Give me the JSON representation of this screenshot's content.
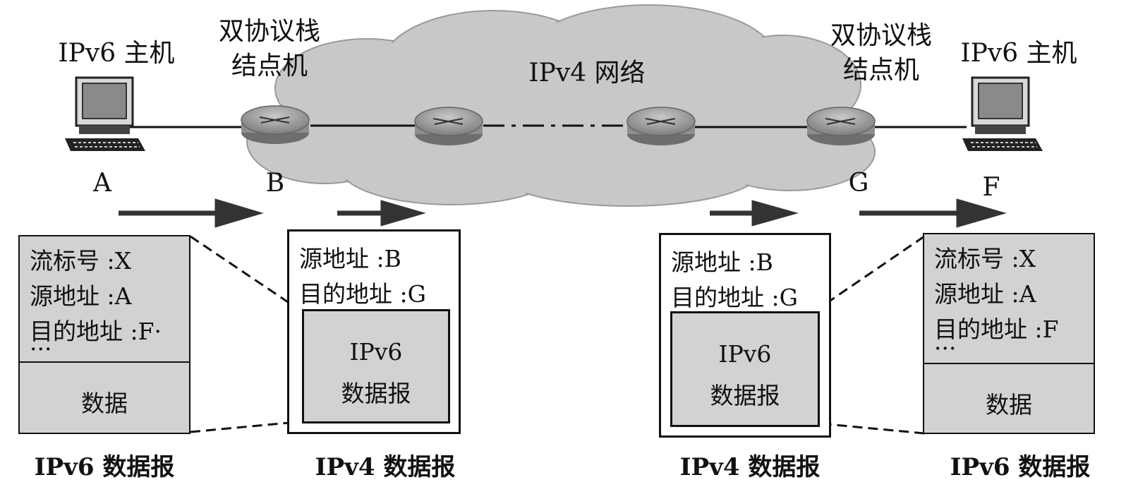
{
  "cloud_label": "IPv4 网络",
  "nodes": {
    "A": {
      "title": "IPv6 主机",
      "letter": "A"
    },
    "B": {
      "title_line1": "双协议栈",
      "title_line2": "结点机",
      "letter": "B"
    },
    "G": {
      "title_line1": "双协议栈",
      "title_line2": "结点机",
      "letter": "G"
    },
    "F": {
      "title": "IPv6 主机",
      "letter": "F"
    }
  },
  "packets": {
    "left_v6": {
      "fields": [
        "流标号 :X",
        "源地址 :A",
        "目的地址 :F·",
        "···"
      ],
      "data_label": "数据",
      "caption": "IPv6 数据报"
    },
    "left_v4": {
      "fields": [
        "源地址 :B",
        "目的地址 :G"
      ],
      "inner_line1": "IPv6",
      "inner_line2": "数据报",
      "caption": "IPv4 数据报"
    },
    "right_v4": {
      "fields": [
        "源地址 :B",
        "目的地址 :G"
      ],
      "inner_line1": "IPv6",
      "inner_line2": "数据报",
      "caption": "IPv4 数据报"
    },
    "right_v6": {
      "fields": [
        "流标号 :X",
        "源地址 :A",
        "目的地址 :F",
        "···"
      ],
      "data_label": "数据",
      "caption": "IPv6 数据报"
    }
  },
  "colors": {
    "cloud_fill": "#c8c8c8",
    "packet_fill": "#d2d2d2",
    "router_fill": "#9a9a9a",
    "arrow": "#333333"
  }
}
